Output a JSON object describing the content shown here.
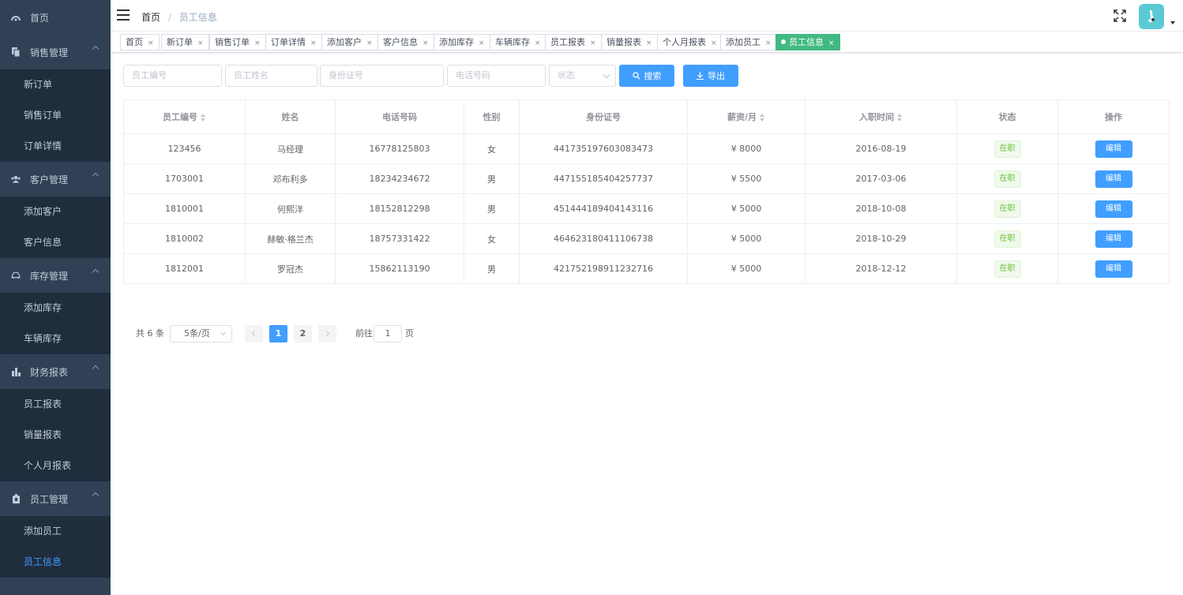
{
  "sidebar": {
    "home": "首页",
    "groups": [
      {
        "label": "销售管理",
        "items": [
          "新订单",
          "销售订单",
          "订单详情"
        ]
      },
      {
        "label": "客户管理",
        "items": [
          "添加客户",
          "客户信息"
        ]
      },
      {
        "label": "库存管理",
        "items": [
          "添加库存",
          "车辆库存"
        ]
      },
      {
        "label": "财务报表",
        "items": [
          "员工报表",
          "销量报表",
          "个人月报表"
        ]
      },
      {
        "label": "员工管理",
        "items": [
          "添加员工",
          "员工信息"
        ]
      }
    ],
    "active_item": "员工信息"
  },
  "breadcrumb": {
    "home": "首页",
    "separator": "/",
    "current": "员工信息"
  },
  "tags": [
    {
      "label": "首页"
    },
    {
      "label": "新订单"
    },
    {
      "label": "销售订单"
    },
    {
      "label": "订单详情"
    },
    {
      "label": "添加客户"
    },
    {
      "label": "客户信息"
    },
    {
      "label": "添加库存"
    },
    {
      "label": "车辆库存"
    },
    {
      "label": "员工报表"
    },
    {
      "label": "销量报表"
    },
    {
      "label": "个人月报表"
    },
    {
      "label": "添加员工"
    },
    {
      "label": "员工信息"
    }
  ],
  "tag_close": "×",
  "filters": {
    "emp_no_placeholder": "员工编号",
    "name_placeholder": "员工姓名",
    "id_placeholder": "身份证号",
    "phone_placeholder": "电话号码",
    "status_placeholder": "状态",
    "search_label": "搜索",
    "export_label": "导出"
  },
  "table": {
    "headers": [
      "员工编号",
      "姓名",
      "电话号码",
      "性别",
      "身份证号",
      "薪资/月",
      "入职时间",
      "状态",
      "操作"
    ],
    "rows": [
      {
        "no": "123456",
        "name": "马经理",
        "phone": "16778125803",
        "gender": "女",
        "id": "441735197603083473",
        "salary": "¥ 8000",
        "date": "2016-08-19",
        "status": "在职",
        "action": "编辑"
      },
      {
        "no": "1703001",
        "name": "邓布利多",
        "phone": "18234234672",
        "gender": "男",
        "id": "447155185404257737",
        "salary": "¥ 5500",
        "date": "2017-03-06",
        "status": "在职",
        "action": "编辑"
      },
      {
        "no": "1810001",
        "name": "何熙洋",
        "phone": "18152812298",
        "gender": "男",
        "id": "451444189404143116",
        "salary": "¥ 5000",
        "date": "2018-10-08",
        "status": "在职",
        "action": "编辑"
      },
      {
        "no": "1810002",
        "name": "赫敏·格兰杰",
        "phone": "18757331422",
        "gender": "女",
        "id": "464623180411106738",
        "salary": "¥ 5000",
        "date": "2018-10-29",
        "status": "在职",
        "action": "编辑"
      },
      {
        "no": "1812001",
        "name": "罗冠杰",
        "phone": "15862113190",
        "gender": "男",
        "id": "421752198911232716",
        "salary": "¥ 5000",
        "date": "2018-12-12",
        "status": "在职",
        "action": "编辑"
      }
    ]
  },
  "pagination": {
    "total": "共 6 条",
    "page_size": "5条/页",
    "pages": [
      "1",
      "2"
    ],
    "current": "1",
    "goto_label": "前往",
    "goto_value": "1",
    "goto_unit": "页"
  },
  "colors": {
    "primary": "#409eff",
    "sidebar": "#304156",
    "submenu": "#1f2d3d",
    "active_tag": "#42b983"
  }
}
